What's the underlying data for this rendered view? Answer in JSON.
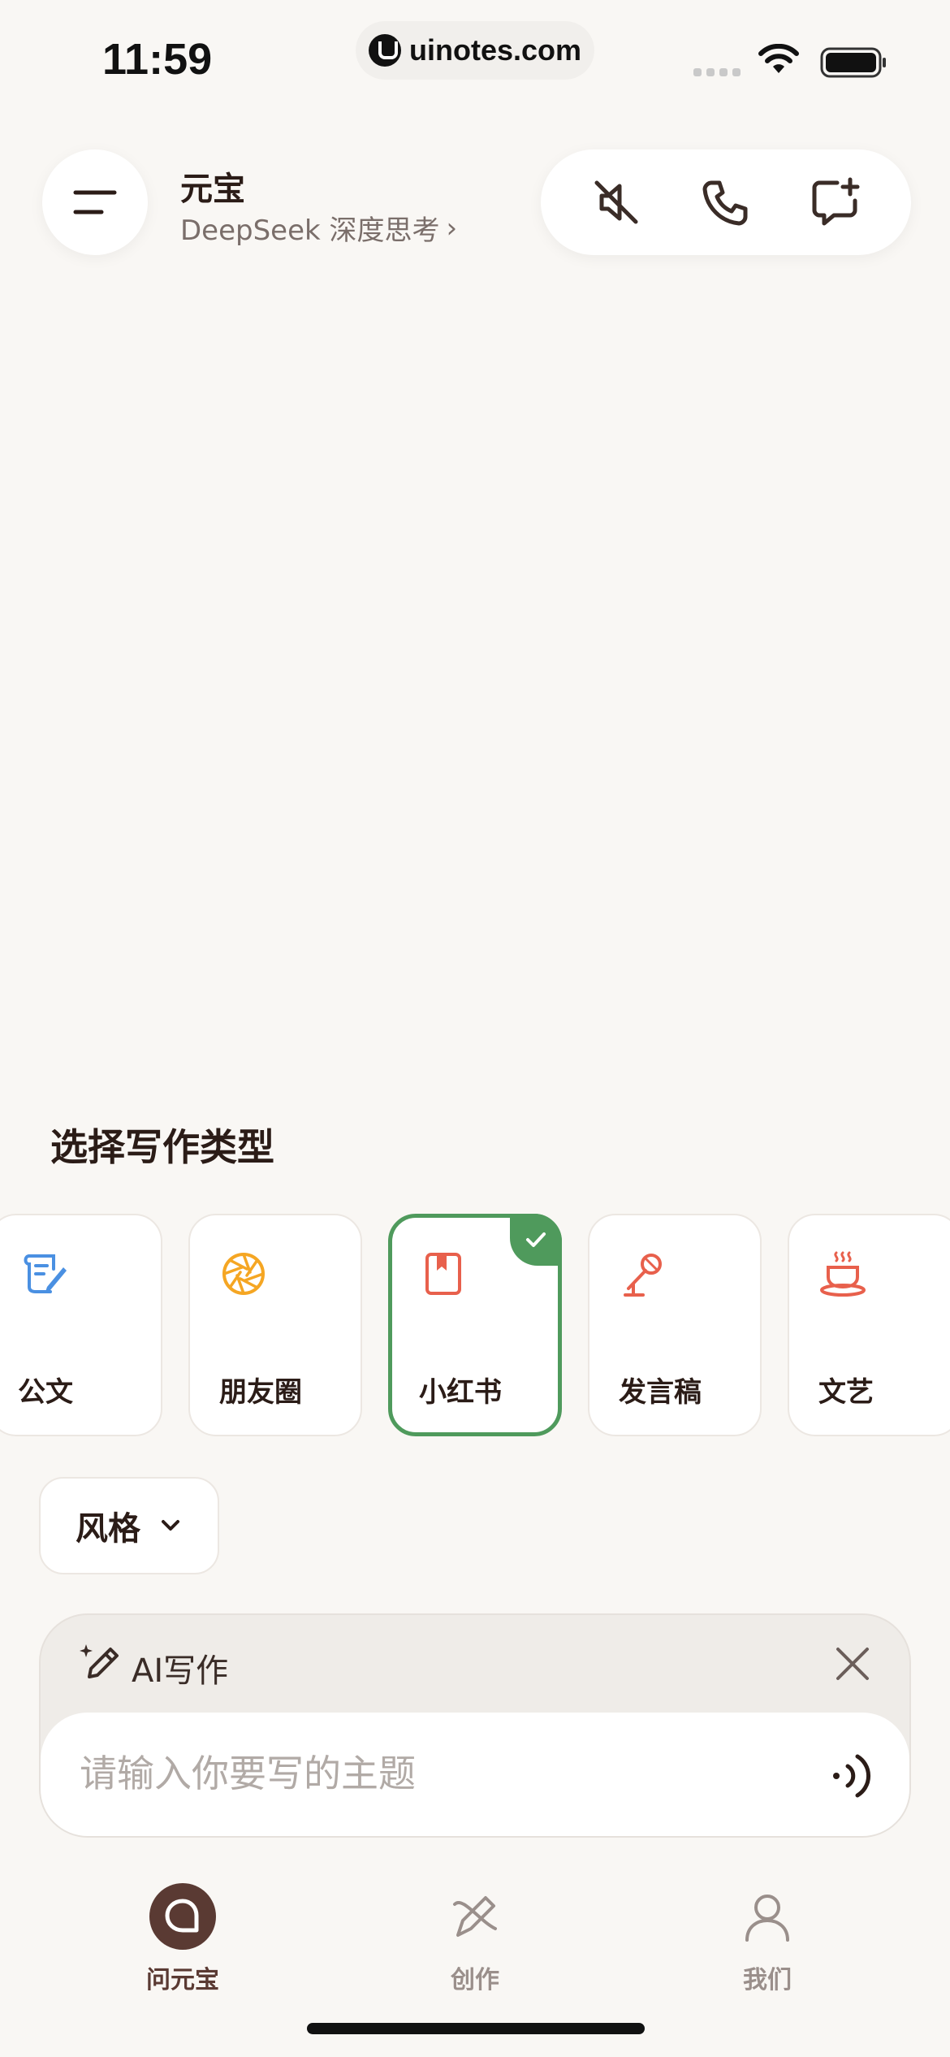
{
  "status_bar": {
    "time": "11:59",
    "url": "uinotes.com"
  },
  "header": {
    "title": "元宝",
    "subtitle": "DeepSeek 深度思考",
    "subtitle_chevron": "›"
  },
  "section": {
    "title": "选择写作类型"
  },
  "cards": [
    {
      "label": "公文",
      "icon": "document-quill-icon",
      "color": "#4a90e2"
    },
    {
      "label": "朋友圈",
      "icon": "aperture-icon",
      "color": "#f5a623"
    },
    {
      "label": "小红书",
      "icon": "notebook-icon",
      "color": "#e8604c",
      "selected": true
    },
    {
      "label": "发言稿",
      "icon": "microphone-icon",
      "color": "#e8604c"
    },
    {
      "label": "文艺",
      "icon": "coffee-cup-icon",
      "color": "#e8604c"
    }
  ],
  "style_button": {
    "label": "风格"
  },
  "composer": {
    "mode_label": "AI写作",
    "placeholder": "请输入你要写的主题",
    "value": ""
  },
  "tabbar": [
    {
      "label": "问元宝",
      "active": true
    },
    {
      "label": "创作",
      "active": false
    },
    {
      "label": "我们",
      "active": false
    }
  ],
  "colors": {
    "background": "#f9f7f4",
    "accent_green": "#4f9a5c",
    "brand_brown": "#5a3a33"
  }
}
